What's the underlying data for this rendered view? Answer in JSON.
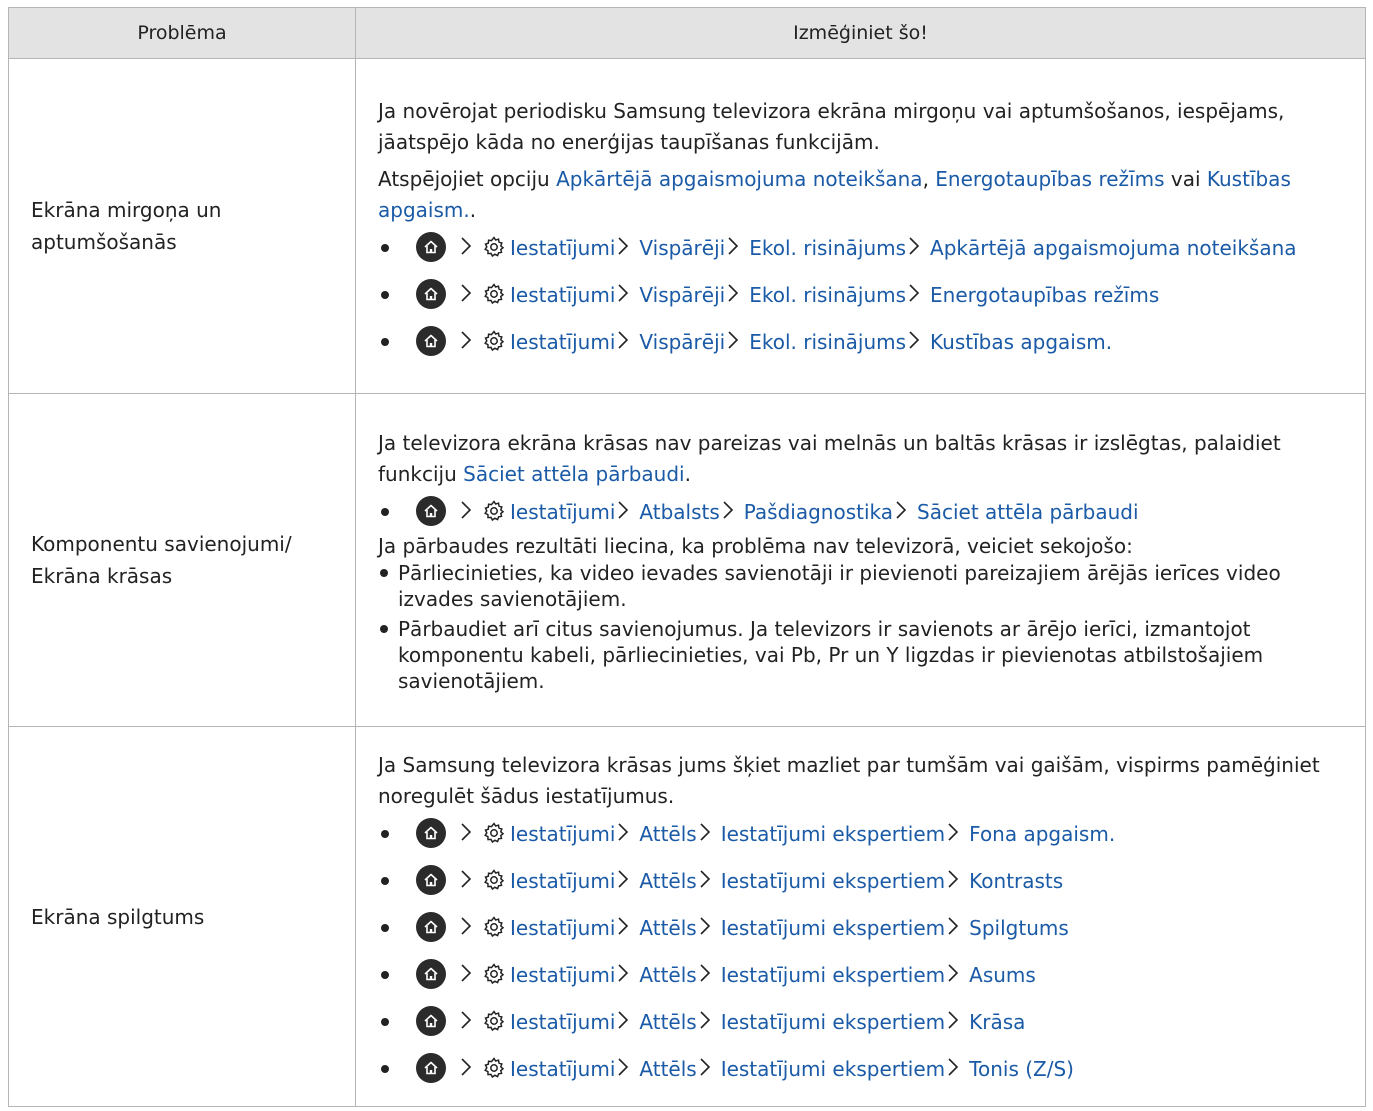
{
  "header": {
    "col1": "Problēma",
    "col2": "Izmēģiniet šo!"
  },
  "rows": [
    {
      "problem": "Ekrāna mirgoņa un aptumšošanās",
      "intro": "Ja novērojat periodisku Samsung televizora ekrāna mirgoņu vai aptumšošanos, iespējams, jāatspējo kāda no enerģijas taupīšanas funkcijām.",
      "p2_prefix": "Atspējojiet opciju ",
      "p2_link1": "Apkārtējā apgaismojuma noteikšana",
      "p2_sep1": ", ",
      "p2_link2": "Energotaupības režīms",
      "p2_sep2": " vai ",
      "p2_link3": "Kustības apgaism.",
      "p2_suffix": ".",
      "steps": [
        [
          "Iestatījumi",
          "Vispārēji",
          "Ekol. risinājums",
          "Apkārtējā apgaismojuma noteikšana"
        ],
        [
          "Iestatījumi",
          "Vispārēji",
          "Ekol. risinājums",
          "Energotaupības režīms"
        ],
        [
          "Iestatījumi",
          "Vispārēji",
          "Ekol. risinājums",
          "Kustības apgaism."
        ]
      ]
    },
    {
      "problem": "Komponentu savienojumi/ Ekrāna krāsas",
      "intro_prefix": "Ja televizora ekrāna krāsas nav pareizas vai melnās un baltās krāsas ir izslēgtas, palaidiet funkciju ",
      "intro_link": "Sāciet attēla pārbaudi",
      "intro_suffix": ".",
      "steps": [
        [
          "Iestatījumi",
          "Atbalsts",
          "Pašdiagnostika",
          "Sāciet attēla pārbaudi"
        ]
      ],
      "after": "Ja pārbaudes rezultāti liecina, ka problēma nav televizorā, veiciet sekojošo:",
      "bullets": [
        "Pārliecinieties, ka video ievades savienotāji ir pievienoti pareizajiem ārējās ierīces video izvades savienotājiem.",
        "Pārbaudiet arī citus savienojumus. Ja televizors ir savienots ar ārējo ierīci, izmantojot komponentu kabeli, pārliecinieties, vai Pb, Pr un Y ligzdas ir pievienotas atbilstošajiem savienotājiem."
      ]
    },
    {
      "problem": "Ekrāna spilgtums",
      "intro": "Ja Samsung televizora krāsas jums šķiet mazliet par tumšām vai gaišām, vispirms pamēģiniet noregulēt šādus iestatījumus.",
      "steps": [
        [
          "Iestatījumi",
          "Attēls",
          "Iestatījumi ekspertiem",
          "Fona apgaism."
        ],
        [
          "Iestatījumi",
          "Attēls",
          "Iestatījumi ekspertiem",
          "Kontrasts"
        ],
        [
          "Iestatījumi",
          "Attēls",
          "Iestatījumi ekspertiem",
          "Spilgtums"
        ],
        [
          "Iestatījumi",
          "Attēls",
          "Iestatījumi ekspertiem",
          "Asums"
        ],
        [
          "Iestatījumi",
          "Attēls",
          "Iestatījumi ekspertiem",
          "Krāsa"
        ],
        [
          "Iestatījumi",
          "Attēls",
          "Iestatījumi ekspertiem",
          "Tonis (Z/S)"
        ]
      ]
    }
  ],
  "icons": {
    "home": "home-icon",
    "settings": "gear-icon",
    "separator": "chevron-right-icon"
  },
  "colors": {
    "link": "#1a5aa6",
    "header_bg": "#e3e3e3",
    "border": "#b5b5b5"
  }
}
